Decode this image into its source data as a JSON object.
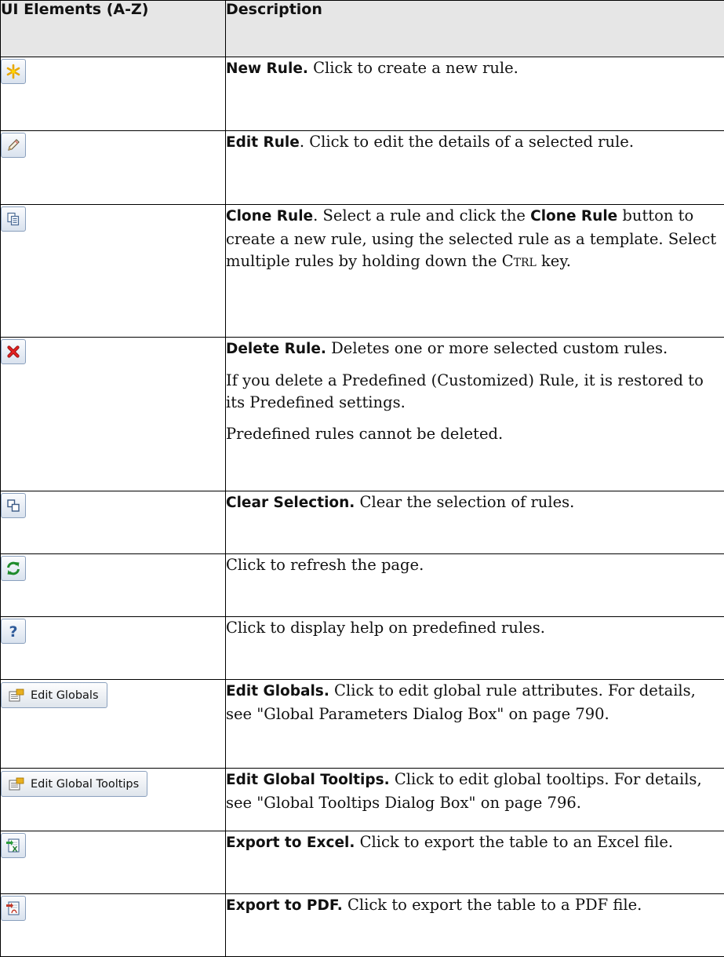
{
  "table": {
    "headers": {
      "col1": "UI Elements (A-Z)",
      "col2": "Description"
    },
    "rows": [
      {
        "icon": "new-rule-icon",
        "term": "New Rule.",
        "text": " Click to create a new rule."
      },
      {
        "icon": "edit-rule-icon",
        "term": "Edit Rule",
        "text": ". Click to edit the details of a selected rule."
      },
      {
        "icon": "clone-rule-icon",
        "term": "Clone Rule",
        "text_a": ". Select a rule and click the ",
        "term_b": "Clone Rule",
        "text_b": " button to create a new rule, using the selected rule as a template. Select multiple rules by holding down the ",
        "key": "Ctrl",
        "text_c": " key."
      },
      {
        "icon": "delete-rule-icon",
        "term": "Delete Rule.",
        "text": " Deletes one or more selected custom rules.",
        "para2": "If you delete a Predefined (Customized) Rule, it is restored to its Predefined settings.",
        "para3": "Predefined rules cannot be deleted."
      },
      {
        "icon": "clear-selection-icon",
        "term": "Clear Selection.",
        "text": " Clear the selection of rules."
      },
      {
        "icon": "refresh-icon",
        "text": "Click to refresh the page."
      },
      {
        "icon": "help-icon",
        "text": "Click to display help on predefined rules."
      },
      {
        "button_label": "Edit Globals",
        "term": "Edit Globals.",
        "text": " Click to edit global rule attributes. For details, see \"Global Parameters Dialog Box\" on page 790."
      },
      {
        "button_label": "Edit Global Tooltips",
        "term": "Edit Global Tooltips.",
        "text": " Click to edit global tooltips. For details, see \"Global Tooltips Dialog Box\" on page 796."
      },
      {
        "icon": "export-excel-icon",
        "term": "Export to Excel.",
        "text": " Click to export the table to an Excel file."
      },
      {
        "icon": "export-pdf-icon",
        "term": "Export to PDF.",
        "text": " Click to export the table to a PDF file."
      }
    ]
  }
}
